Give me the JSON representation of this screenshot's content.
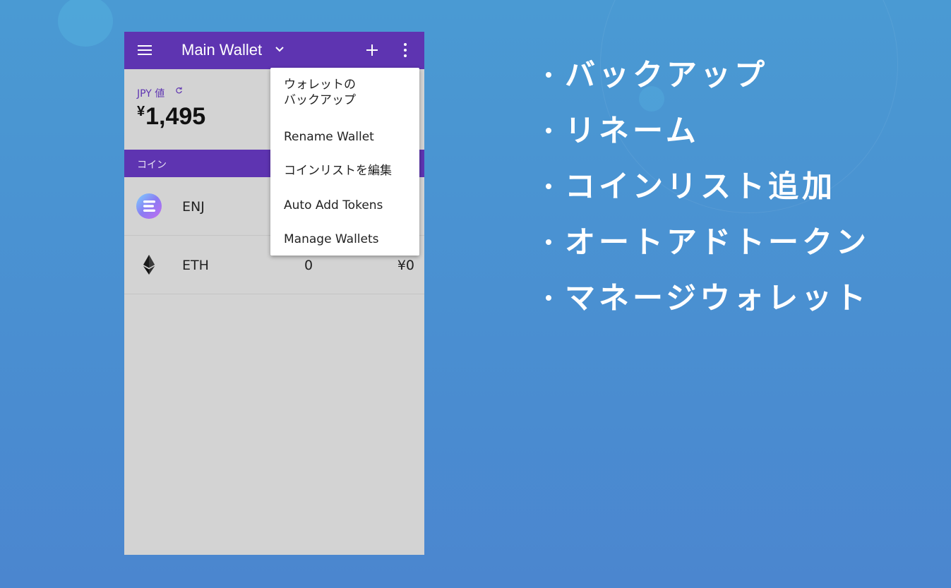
{
  "app": {
    "wallet_name": "Main Wallet",
    "value_label": "JPY 値",
    "balance_symbol": "¥",
    "balance_value": "1,495",
    "coin_header": "コイン"
  },
  "coins": [
    {
      "symbol": "ENJ",
      "amount": "",
      "fiat": "",
      "icon": "enjin-coin-icon"
    },
    {
      "symbol": "ETH",
      "amount": "0",
      "fiat": "¥0",
      "icon": "ethereum-icon"
    }
  ],
  "menu": {
    "items": [
      {
        "line1": "ウォレットの",
        "line2": "バックアップ"
      },
      {
        "label": "Rename Wallet"
      },
      {
        "label": "コインリストを編集"
      },
      {
        "label": "Auto Add Tokens"
      },
      {
        "label": "Manage Wallets"
      }
    ]
  },
  "features": [
    "バックアップ",
    "リネーム",
    "コインリスト追加",
    "オートアドトークン",
    "マネージウォレット"
  ],
  "colors": {
    "accent": "#5e34b1",
    "background": "#4a8fd1",
    "surface": "#d3d3d3"
  }
}
